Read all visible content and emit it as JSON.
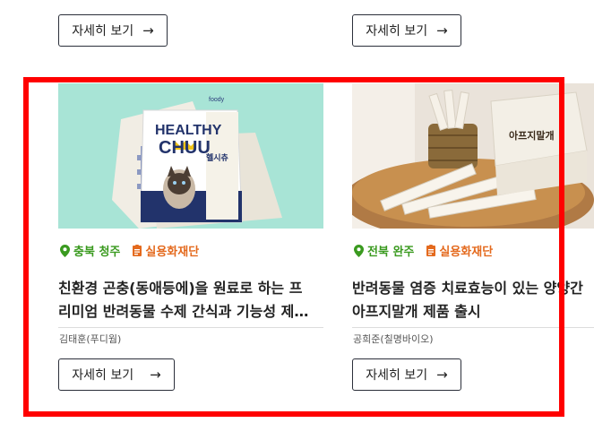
{
  "top_buttons": [
    {
      "label": "자세히 보기",
      "arrow": "→"
    },
    {
      "label": "자세히 보기",
      "arrow": "→"
    }
  ],
  "cards": [
    {
      "image_icon": "healthy-chuu-product-photo",
      "product_brand": "foody",
      "product_name_en_1": "HEALTHY",
      "product_name_en_2": "CHUU",
      "product_name_ko": "헬시츄",
      "location": "충북 청주",
      "category": "실용화재단",
      "title_line1": "친환경 곤충(동애등에)을 원료로 하는 프",
      "title_line2": "리미엄 반려동물 수제 간식과 기능성 제…",
      "author": "김태훈(푸디웜)",
      "button_label": "자세히 보기",
      "button_arrow": "→"
    },
    {
      "image_icon": "dog-supplement-sticks-photo",
      "box_label": "아프지말개",
      "location": "전북 완주",
      "category": "실용화재단",
      "title_line1": "반려동물 염증 치료효능이 있는 양양간",
      "title_line2": "아프지말개 제품 출시",
      "author": "공희준(칠명바이오)",
      "button_label": "자세히 보기",
      "button_arrow": "→"
    }
  ],
  "colors": {
    "location_green": "#3a9a1f",
    "category_orange": "#e46a1e",
    "highlight_red": "#ff0000",
    "image1_bg": "#a8e4d6"
  }
}
